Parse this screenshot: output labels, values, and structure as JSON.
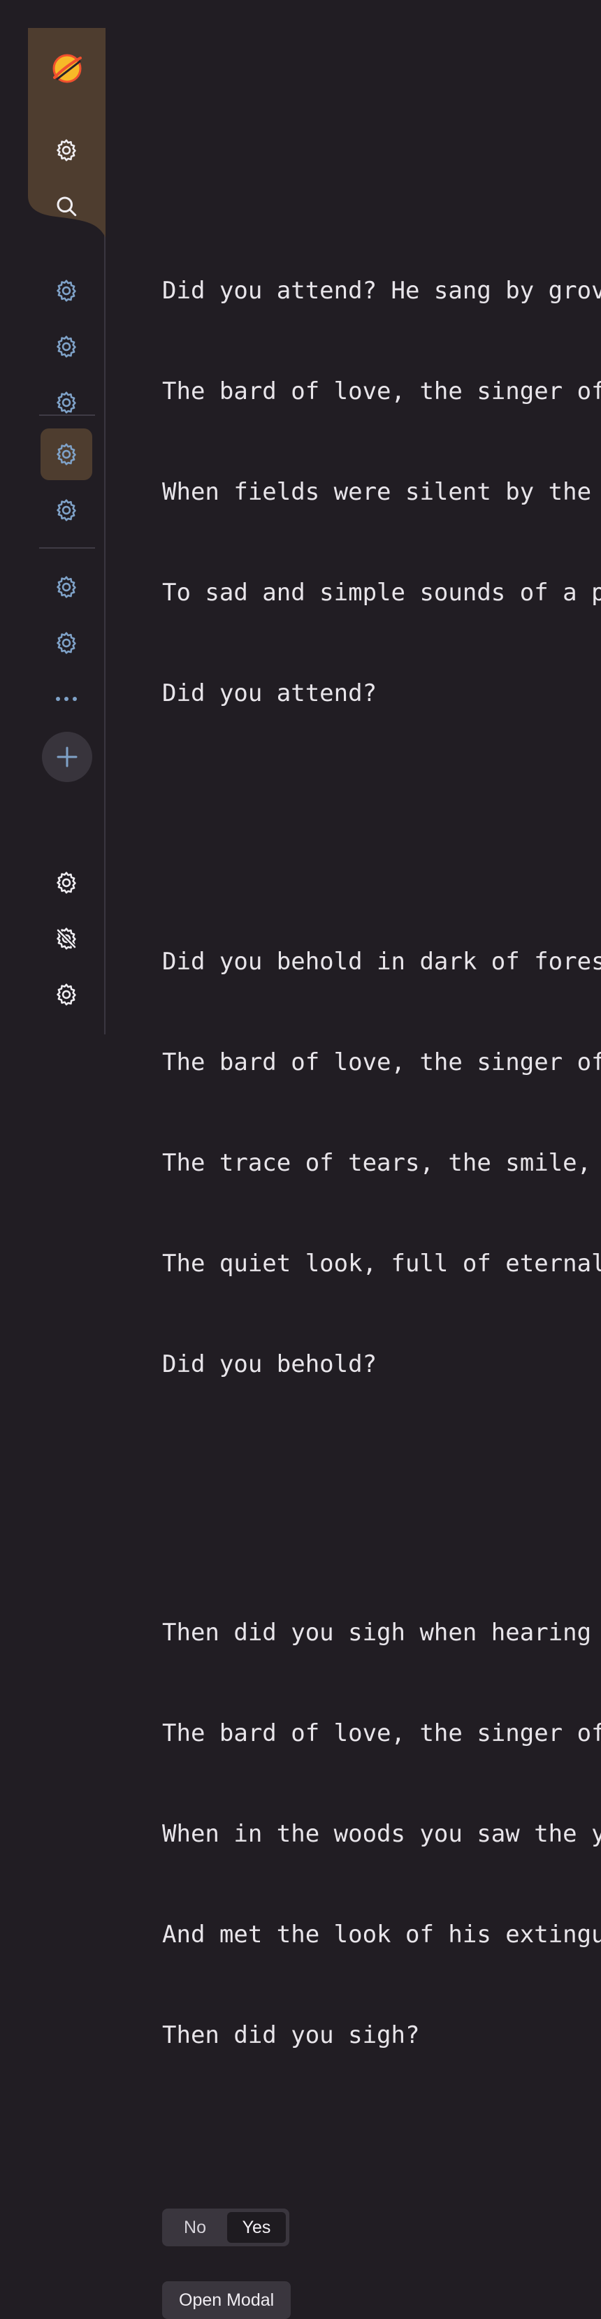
{
  "app": {
    "logo": "planet-logo-icon",
    "colors": {
      "background": "#211d23",
      "sidebar_header": "#4e3d2f",
      "active_item": "#4e3d2f",
      "icon_blue": "#7fa2c8",
      "icon_white": "#f0eef2",
      "button_bg": "#3a363e"
    }
  },
  "sidebar": {
    "top_icons": [
      "settings-icon",
      "search-icon"
    ],
    "group1_icons": [
      "settings-icon",
      "settings-icon",
      "settings-icon"
    ],
    "group2_icons": [
      "settings-icon",
      "settings-icon"
    ],
    "group2_active_index": 0,
    "group3_icons": [
      "settings-icon",
      "settings-icon"
    ],
    "more": "more-horizontal-icon",
    "add": "plus-icon",
    "bottom_icons": [
      "settings-icon",
      "debug-off-icon",
      "settings-icon"
    ]
  },
  "poem": {
    "stanzas": [
      [
        "Did you attend? He sang by grove",
        "The bard of love, the singer of",
        "When fields were silent by the",
        "To sad and simple sounds of a p",
        "Did you attend?"
      ],
      [
        "Did you behold in dark of fores",
        "The bard of love, the singer of",
        "The trace of tears, the smile,",
        "The quiet look, full of eternal",
        "Did you behold?"
      ],
      [
        "Then did you sigh when hearing",
        "The bard of love, the singer of",
        "When in the woods you saw the y",
        "And met the look of his extingu",
        "Then did you sigh?"
      ]
    ]
  },
  "toggle": {
    "options": [
      "No",
      "Yes"
    ],
    "selected": "Yes"
  },
  "modal_button": {
    "label": "Open Modal"
  }
}
